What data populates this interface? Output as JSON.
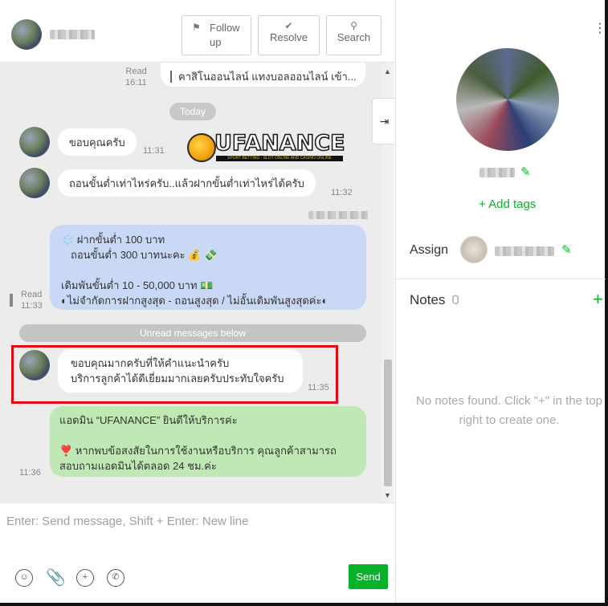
{
  "header": {
    "buttons": {
      "follow_up": "Follow up",
      "resolve": "Resolve",
      "search": "Search"
    }
  },
  "messages": {
    "top": {
      "status": "Read",
      "time": "16:11",
      "text": "คาสิโนออนไลน์ แทงบอลออนไลน์ เข้า..."
    },
    "today_label": "Today",
    "logo": {
      "text": "UFANANCE",
      "tagline": "SPORT BETTING · SLOT ONLINE AND CASINO ONLINE"
    },
    "incoming_1": {
      "text": "ขอบคุณครับ",
      "time": "11:31"
    },
    "incoming_2": {
      "text": "ถอนขั้นต่ำเท่าไหร่ครับ..แล้วฝากขั้นต่ำเท่าไหร่ได้ครับ",
      "time": "11:32"
    },
    "outgoing_1": {
      "status": "Read",
      "time": "11:33",
      "line1": "❄️ ฝากขั้นต่ำ 100 บาท",
      "line2": "ถอนขั้นต่ำ 300 บาทนะคะ 💰 💸",
      "line3": "เดิมพันขั้นต่ำ 10 - 50,000 บาท 💵",
      "line4": "◐ไม่จำกัดการฝากสูงสุด - ถอนสูงสุด  / ไม่อั้นเดิมพันสูงสุดค่ะ◐"
    },
    "unread_label": "Unread messages below",
    "incoming_3": {
      "line1": "ขอบคุณมากครับที่ให้คำแนะนำครับ",
      "line2": "บริการลูกค้าได้ดีเยี่ยมมากเลยครับประทับใจครับ",
      "time": "11:35"
    },
    "outgoing_2": {
      "time": "11:36",
      "line1": "แอดมิน “UFANANCE” ยินดีให้บริการค่ะ",
      "line2": "❣️ หากพบข้อสงสัยในการใช้งานหรือบริการ คุณลูกค้าสามารถ",
      "line3": "สอบถามแอดมินได้ตลอด 24 ชม.ค่ะ"
    }
  },
  "composer": {
    "placeholder": "Enter: Send message, Shift + Enter: New line",
    "send_label": "Send"
  },
  "profile": {
    "add_tags": "+ Add tags",
    "assign_label": "Assign",
    "notes_title": "Notes",
    "notes_count": "0",
    "notes_add": "+",
    "notes_empty": "No notes found. Click \"+\" in the top right to create one."
  },
  "colors": {
    "accent_green": "#06b22a",
    "bubble_blue": "#c9d8f5",
    "bubble_green": "#bfe8b5",
    "highlight_red": "#e30613"
  }
}
